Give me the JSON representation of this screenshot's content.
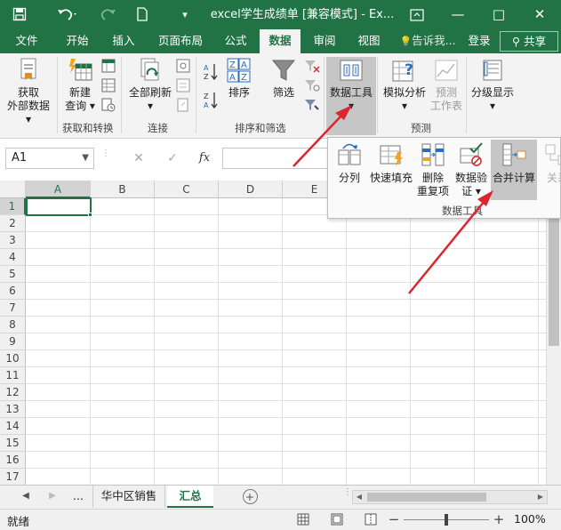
{
  "window": {
    "title": "excel学生成绩单 [兼容模式] - Ex...",
    "restore_icon": "ribbon-display-icon",
    "minimize_label": "—",
    "maximize_label": "□",
    "close_label": "✕"
  },
  "tabs": [
    "文件",
    "开始",
    "插入",
    "页面布局",
    "公式",
    "数据",
    "审阅",
    "视图"
  ],
  "active_tab": "数据",
  "tell_me": "告诉我...",
  "login": "登录",
  "share": "共享",
  "ribbon": {
    "get_external": [
      "获取",
      "外部数据"
    ],
    "new_query": [
      "新建",
      "查询"
    ],
    "refresh_all": "全部刷新",
    "sort": "排序",
    "filter": "筛选",
    "data_tools": "数据工具",
    "what_if": "模拟分析",
    "forecast_sheet": [
      "预测",
      "工作表"
    ],
    "outline": "分级显示",
    "groups": {
      "get_transform": "获取和转换",
      "connections": "连接",
      "sort_filter": "排序和筛选",
      "forecast": "预测"
    }
  },
  "dropdown": {
    "text_to_columns": "分列",
    "flash_fill": "快速填充",
    "remove_dup": [
      "删除",
      "重复项"
    ],
    "validation": [
      "数据验",
      "证"
    ],
    "consolidate": "合并计算",
    "relationships": "关系",
    "group_label": "数据工具"
  },
  "formula_bar": {
    "name_box": "A1",
    "cancel": "✕",
    "enter": "✓",
    "fx": "fx"
  },
  "columns": [
    "A",
    "B",
    "C",
    "D",
    "E"
  ],
  "rows": [
    "1",
    "2",
    "3",
    "4",
    "5",
    "6",
    "7",
    "8",
    "9",
    "10",
    "11",
    "12",
    "13",
    "14",
    "15",
    "16",
    "17"
  ],
  "sheets": {
    "more": "...",
    "items": [
      "华中区销售",
      "汇总"
    ],
    "active": "汇总",
    "add": "+"
  },
  "status": {
    "ready": "就绪",
    "zoom_minus": "−",
    "zoom_plus": "+",
    "zoom": "100%",
    "zoom_level": 0.5
  },
  "colors": {
    "excel_green": "#217346",
    "arrow_red": "#d9262f"
  }
}
